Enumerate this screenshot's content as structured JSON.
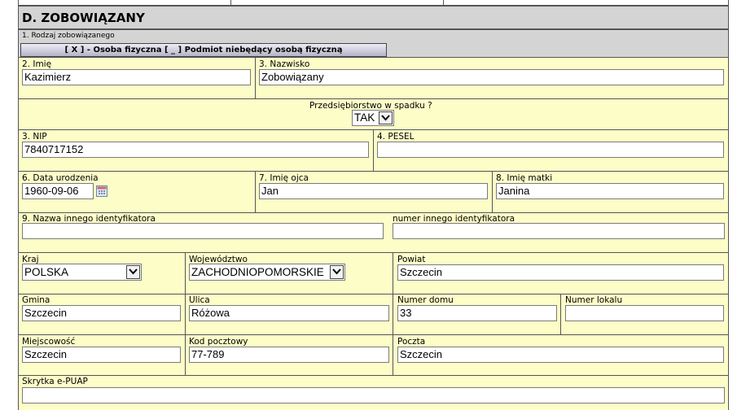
{
  "section": {
    "title": "D. ZOBOWIĄZANY",
    "rodzaj_label": "1. Rodzaj zobowiązanego",
    "rodzaj_button": "[ X ] - Osoba fizyczna [ _ ] Podmiot niebędący osobą fizyczną"
  },
  "fields": {
    "imie": {
      "label": "2. Imię",
      "value": "Kazimierz"
    },
    "nazwisko": {
      "label": "3. Nazwisko",
      "value": "Zobowiązany"
    },
    "przedsiebiorstwo": {
      "label": "Przedsiębiorstwo w spadku ?",
      "value": "TAK"
    },
    "nip": {
      "label": "3. NIP",
      "value": "7840717152"
    },
    "pesel": {
      "label": "4. PESEL",
      "value": ""
    },
    "data_urodzenia": {
      "label": "6. Data urodzenia",
      "value": "1960-09-06"
    },
    "imie_ojca": {
      "label": "7. Imię ojca",
      "value": "Jan"
    },
    "imie_matki": {
      "label": "8. Imię matki",
      "value": "Janina"
    },
    "nazwa_identyfikatora": {
      "label": "9. Nazwa innego identyfikatora",
      "value": ""
    },
    "numer_identyfikatora": {
      "label": "numer innego identyfikatora",
      "value": ""
    },
    "kraj": {
      "label": "Kraj",
      "value": "POLSKA"
    },
    "wojewodztwo": {
      "label": "Województwo",
      "value": "ZACHODNIOPOMORSKIE"
    },
    "powiat": {
      "label": "Powiat",
      "value": "Szczecin"
    },
    "gmina": {
      "label": "Gmina",
      "value": "Szczecin"
    },
    "ulica": {
      "label": "Ulica",
      "value": "Różowa"
    },
    "numer_domu": {
      "label": "Numer domu",
      "value": "33"
    },
    "numer_lokalu": {
      "label": "Numer lokalu",
      "value": ""
    },
    "miejscowosc": {
      "label": "Miejscowość",
      "value": "Szczecin"
    },
    "kod_pocztowy": {
      "label": "Kod pocztowy",
      "value": "77-789"
    },
    "poczta": {
      "label": "Poczta",
      "value": "Szczecin"
    },
    "skrytka": {
      "label": "Skrytka e-PUAP",
      "value": ""
    }
  },
  "icons": {
    "dropdown": "chevron-down-icon",
    "calendar": "calendar-icon"
  },
  "colors": {
    "cell_background": "#fdfdc8",
    "header_background": "#d4d4d4",
    "border": "#555555"
  }
}
